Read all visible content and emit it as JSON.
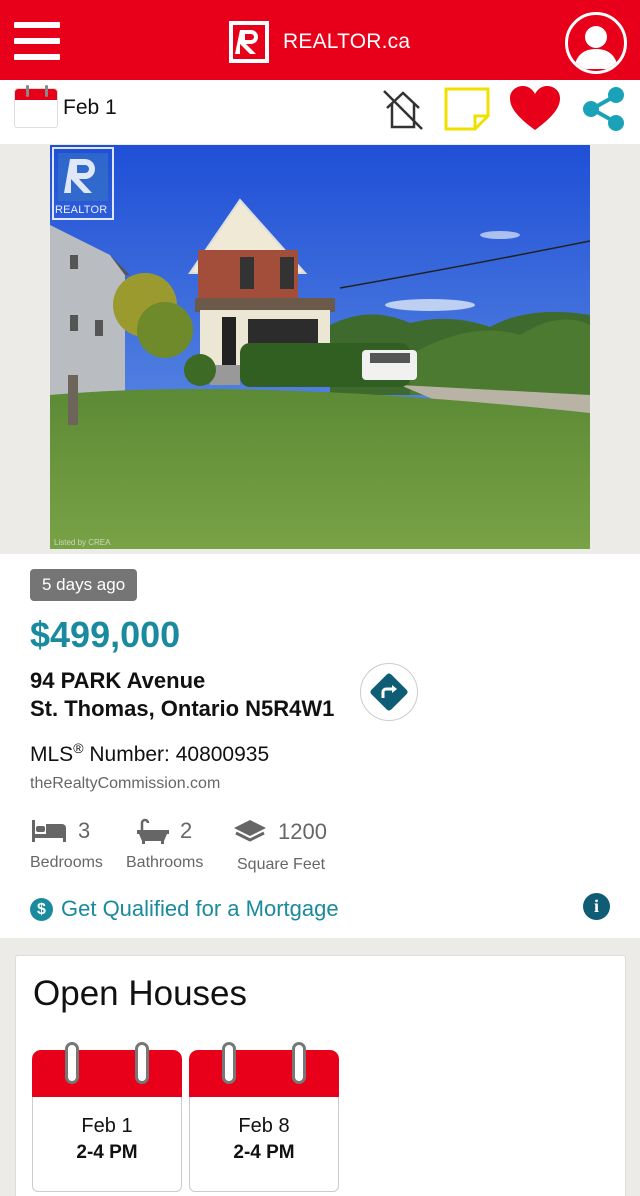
{
  "header": {
    "logo_text": "REALTOR.ca",
    "menu_icon": "hamburger-menu-icon",
    "profile_icon": "user-account-icon",
    "brand_color": "#e8001a"
  },
  "action_bar": {
    "date": "Feb 1",
    "calendar_icon": "calendar-icon",
    "hide_icon": "crossed-house-icon",
    "note_icon": "sticky-note-icon",
    "favorite_icon": "heart-icon",
    "share_icon": "share-icon"
  },
  "photo": {
    "watermark_text": "REALTOR",
    "credit_text": "Listed by CREA"
  },
  "listing": {
    "posted": "5 days ago",
    "price": "$499,000",
    "address_line1": "94 PARK Avenue",
    "address_line2": "St. Thomas, Ontario N5R4W1",
    "mls_prefix": "MLS",
    "mls_reg": "®",
    "mls_suffix": " Number: 40800935",
    "brokerage": "theRealtyCommission.com",
    "price_color": "#1a8a9e",
    "specs": [
      {
        "value": "3",
        "label": "Bedrooms",
        "icon": "bed-icon"
      },
      {
        "value": "2",
        "label": "Bathrooms",
        "icon": "bathtub-icon"
      },
      {
        "value": "1200",
        "label": "Square Feet",
        "icon": "layers-icon"
      }
    ],
    "mortgage_label": "Get Qualified for a Mortgage",
    "mortgage_icon": "dollar-icon",
    "info_icon": "info-icon"
  },
  "open_houses": {
    "title": "Open Houses",
    "dates": [
      {
        "day": "Feb 1",
        "time": "2-4 PM"
      },
      {
        "day": "Feb 8",
        "time": "2-4 PM"
      }
    ]
  }
}
